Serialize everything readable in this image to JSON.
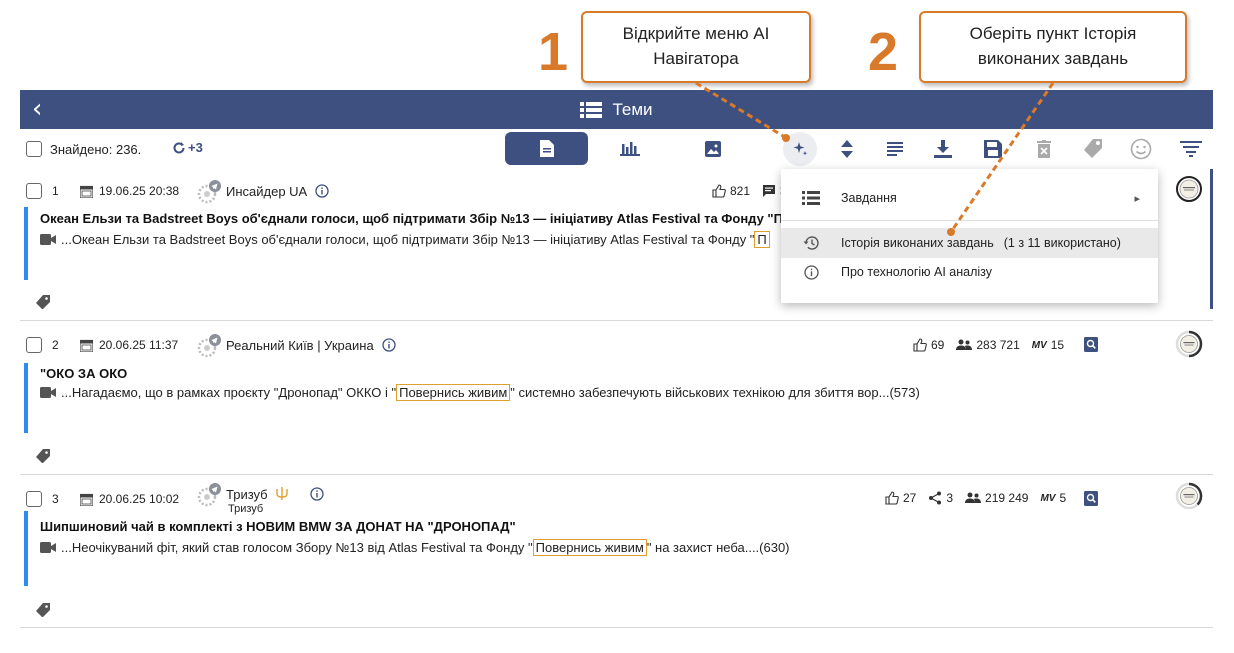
{
  "callouts": [
    {
      "number": "1",
      "text": "Відкрийте меню AI Навігатора"
    },
    {
      "number": "2",
      "text": "Оберіть пункт Історія виконаних завдань"
    }
  ],
  "header": {
    "back_icon": "chevron-left-icon",
    "title": "Теми",
    "title_icon": "list-icon"
  },
  "toolbar": {
    "found_label": "Знайдено: 236.",
    "refresh_label": "+3",
    "view_tabs": [
      {
        "name": "documents",
        "icon": "document-icon",
        "active": true
      },
      {
        "name": "analytics",
        "icon": "bar-chart-icon",
        "active": false
      },
      {
        "name": "images",
        "icon": "image-icon",
        "active": false
      }
    ],
    "tools": [
      "ai-sparkle-icon",
      "sort-icon",
      "text-icon",
      "download-icon",
      "save-icon",
      "delete-icon",
      "tag-icon",
      "smile-icon",
      "filter-icon"
    ]
  },
  "menu": {
    "items": [
      {
        "label": "Завдання",
        "icon": "list-icon",
        "has_submenu": true
      },
      {
        "label": "Історія виконаних завдань",
        "suffix": "(1 з 11 використано)",
        "icon": "history-icon",
        "highlighted": true
      },
      {
        "label": "Про технологію AI аналізу",
        "icon": "info-icon"
      }
    ]
  },
  "items": [
    {
      "num": "1",
      "date": "19.06.25 20:38",
      "source": "Инсайдер UA",
      "source_sub": "",
      "title": "Океан Ельзи та Badstreet Boys об'єднали голоси, щоб підтримати Збір №13 — ініціативу Atlas Festival та Фонду \"Повер",
      "text_before": "...Океан Ельзи та Badstreet Boys об'єднали голоси, щоб підтримати Збір №13 — ініціативу Atlas Festival та Фонду \"",
      "highlight": "П",
      "text_after": "",
      "likes": "821",
      "comments": "3",
      "shares": "",
      "audience": "",
      "mv": ""
    },
    {
      "num": "2",
      "date": "20.06.25 11:37",
      "source": "Реальний Київ | Украина",
      "source_sub": "",
      "title": "\"ОКО ЗА ОКО",
      "text_before": "...Нагадаємо, що в рамках проєкту \"Дронопад\" ОККО і \"",
      "highlight": "Повернись живим",
      "text_after": "\" системно забезпечують військових технікою для збиття вор...(573)",
      "likes": "69",
      "comments": "",
      "shares": "",
      "audience": "283 721",
      "mv": "15"
    },
    {
      "num": "3",
      "date": "20.06.25 10:02",
      "source": "Тризуб",
      "source_sub": "Тризуб",
      "title": "Шипшиновий чай в комплекті з НОВИМ BMW ЗА ДОНАТ НА \"ДРОНОПАД\"",
      "text_before": "...Неочікуваний фіт, який став голосом Збору №13 від Atlas Festival та Фонду \"",
      "highlight": "Повернись живим",
      "text_after": "\" на захист неба....(630)",
      "likes": "27",
      "comments": "",
      "shares": "3",
      "audience": "219 249",
      "mv": "5"
    }
  ],
  "labels": {
    "mv": "MV"
  },
  "colors": {
    "header_bg": "#3d5080",
    "accent_bar": "#2d8cf0",
    "callout": "#d97a2b",
    "highlight_border": "#e0a030"
  }
}
